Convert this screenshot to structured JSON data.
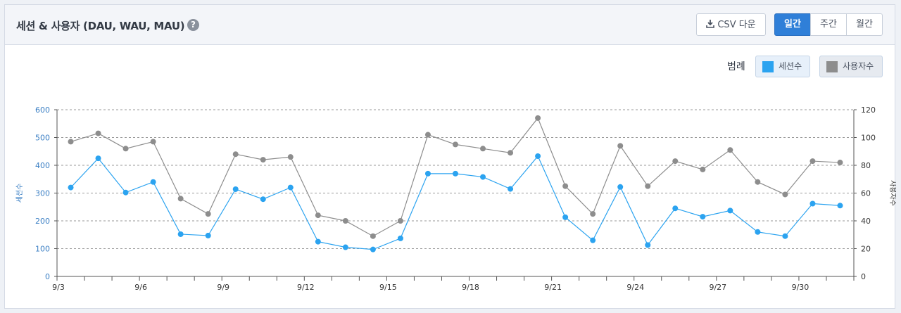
{
  "header": {
    "title": "세션 & 사용자 (DAU, WAU, MAU)",
    "help_glyph": "?",
    "csv_label": "CSV 다운",
    "periods": [
      "일간",
      "주간",
      "월간"
    ],
    "active_period": "일간"
  },
  "legend": {
    "label": "범례",
    "items": [
      {
        "name": "세션수",
        "color": "#2ba3f0"
      },
      {
        "name": "사용자수",
        "color": "#8d8d8d"
      }
    ]
  },
  "chart_data": {
    "type": "line",
    "x": [
      "9/3",
      "9/4",
      "9/5",
      "9/6",
      "9/7",
      "9/8",
      "9/9",
      "9/10",
      "9/11",
      "9/12",
      "9/13",
      "9/14",
      "9/15",
      "9/16",
      "9/17",
      "9/18",
      "9/19",
      "9/20",
      "9/21",
      "9/22",
      "9/23",
      "9/24",
      "9/25",
      "9/26",
      "9/27",
      "9/28",
      "9/29",
      "9/30",
      "10/1"
    ],
    "tick_labels": [
      "9/3",
      "9/6",
      "9/9",
      "9/12",
      "9/15",
      "9/18",
      "9/21",
      "9/24",
      "9/27",
      "9/30"
    ],
    "series": [
      {
        "name": "세션수",
        "axis": "left",
        "color": "#2ba3f0",
        "values": [
          320,
          425,
          302,
          340,
          152,
          147,
          314,
          278,
          320,
          125,
          105,
          97,
          137,
          370,
          370,
          358,
          315,
          433,
          213,
          130,
          322,
          113,
          245,
          215,
          237,
          160,
          145,
          262,
          255
        ]
      },
      {
        "name": "사용자수",
        "axis": "right",
        "color": "#8d8d8d",
        "values": [
          97,
          103,
          92,
          97,
          56,
          45,
          88,
          84,
          86,
          44,
          40,
          29,
          40,
          102,
          95,
          92,
          89,
          114,
          65,
          45,
          94,
          65,
          83,
          77,
          91,
          68,
          59,
          83,
          82
        ]
      }
    ],
    "ylabel": "세션수",
    "y2label": "사용자수",
    "ylim": [
      0,
      600
    ],
    "y2lim": [
      0,
      120
    ],
    "yticks": [
      0,
      100,
      200,
      300,
      400,
      500,
      600
    ],
    "y2ticks": [
      0,
      20,
      40,
      60,
      80,
      100,
      120
    ],
    "grid": true
  }
}
